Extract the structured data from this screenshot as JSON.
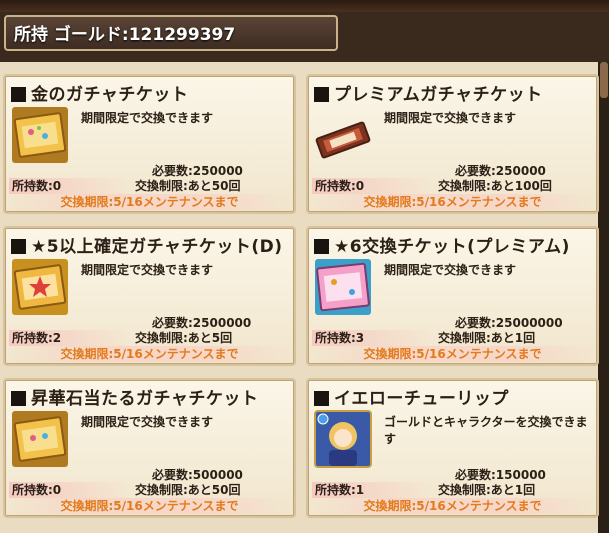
{
  "header": {
    "gold_label": "所持 ゴールド:121299397"
  },
  "cards": [
    {
      "title": "金のガチャチケット",
      "desc": "期間限定で交換できます",
      "required": "必要数:250000",
      "owned": "所持数:0",
      "limit": "交換制限:あと50回",
      "deadline": "交換期限:5/16メンテナンスまで",
      "icon": "gold-ticket-icon"
    },
    {
      "title": "プレミアムガチャチケット",
      "desc": "期間限定で交換できます",
      "required": "必要数:250000",
      "owned": "所持数:0",
      "limit": "交換制限:あと100回",
      "deadline": "交換期限:5/16メンテナンスまで",
      "icon": "premium-ticket-icon"
    },
    {
      "title": "★5以上確定ガチャチケット(D)",
      "desc": "期間限定で交換できます",
      "required": "必要数:2500000",
      "owned": "所持数:2",
      "limit": "交換制限:あと5回",
      "deadline": "交換期限:5/16メンテナンスまで",
      "icon": "star5-ticket-icon"
    },
    {
      "title": "★6交換チケット(プレミアム)",
      "desc": "期間限定で交換できます",
      "required": "必要数:25000000",
      "owned": "所持数:3",
      "limit": "交換制限:あと1回",
      "deadline": "交換期限:5/16メンテナンスまで",
      "icon": "star6-ticket-icon"
    },
    {
      "title": "昇華石当たるガチャチケット",
      "desc": "期間限定で交換できます",
      "required": "必要数:500000",
      "owned": "所持数:0",
      "limit": "交換制限:あと50回",
      "deadline": "交換期限:5/16メンテナンスまで",
      "icon": "sublimation-ticket-icon"
    },
    {
      "title": "イエローチューリップ",
      "desc": "ゴールドとキャラクターを交換できます",
      "required": "必要数:150000",
      "owned": "所持数:1",
      "limit": "交換制限:あと1回",
      "deadline": "交換期限:5/16メンテナンスまで",
      "icon": "character-portrait-icon"
    }
  ]
}
